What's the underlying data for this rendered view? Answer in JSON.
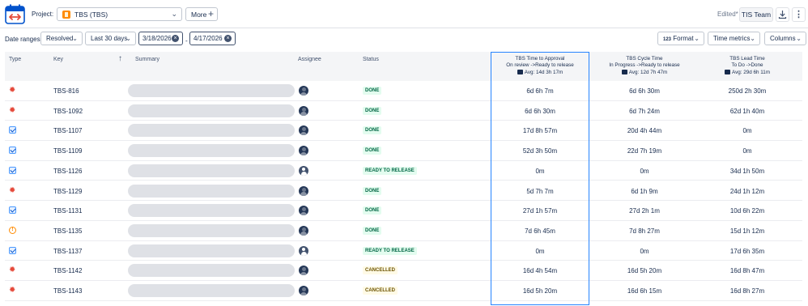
{
  "header": {
    "project_label": "Project:",
    "project_value": "TBS (TBS)",
    "more_label": "More",
    "edited_label": "Edited*",
    "team_label": "TIS Team"
  },
  "filters": {
    "date_ranges_label": "Date ranges:",
    "status_filter": "Resolved",
    "period_filter": "Last 30 days",
    "date_from": "3/18/2026",
    "date_separator": "-",
    "date_to": "4/17/2026",
    "format_label": "Format",
    "time_metrics_label": "Time metrics",
    "columns_label": "Columns"
  },
  "table": {
    "columns": {
      "type": "Type",
      "key": "Key",
      "summary": "Summary",
      "assignee": "Assignee",
      "status": "Status"
    },
    "metric_columns": [
      {
        "title": "TBS Time to Approval",
        "subtitle": "On review ->Ready to release",
        "avg": "Avg: 14d 3h 17m"
      },
      {
        "title": "TBS Cycle Time",
        "subtitle": "In Progress ->Ready to release",
        "avg": "Avg: 12d 7h 47m"
      },
      {
        "title": "TBS Lead Time",
        "subtitle": "To Do ->Done",
        "avg": "Avg: 29d 6h 11m"
      }
    ],
    "rows": [
      {
        "type": "bug",
        "key": "TBS-816",
        "avatar": "photo",
        "status": "DONE",
        "approval": "6d 6h 7m",
        "cycle": "6d 6h 30m",
        "lead": "250d 2h 30m"
      },
      {
        "type": "bug",
        "key": "TBS-1092",
        "avatar": "photo",
        "status": "DONE",
        "approval": "6d 6h 30m",
        "cycle": "6d 7h 24m",
        "lead": "62d 1h 40m"
      },
      {
        "type": "task",
        "key": "TBS-1107",
        "avatar": "photo",
        "status": "DONE",
        "approval": "17d 8h 57m",
        "cycle": "20d 4h 44m",
        "lead": "0m"
      },
      {
        "type": "task",
        "key": "TBS-1109",
        "avatar": "photo",
        "status": "DONE",
        "approval": "52d 3h 50m",
        "cycle": "22d 7h 19m",
        "lead": "0m"
      },
      {
        "type": "task",
        "key": "TBS-1126",
        "avatar": "generic",
        "status": "READY TO RELEASE",
        "approval": "0m",
        "cycle": "0m",
        "lead": "34d 1h 50m"
      },
      {
        "type": "bug",
        "key": "TBS-1129",
        "avatar": "photo",
        "status": "DONE",
        "approval": "5d 7h 7m",
        "cycle": "6d 1h 9m",
        "lead": "24d 1h 12m"
      },
      {
        "type": "task",
        "key": "TBS-1131",
        "avatar": "photo",
        "status": "DONE",
        "approval": "27d 1h 57m",
        "cycle": "27d 2h 1m",
        "lead": "10d 6h 22m"
      },
      {
        "type": "warn",
        "key": "TBS-1135",
        "avatar": "photo",
        "status": "DONE",
        "approval": "7d 6h 45m",
        "cycle": "7d 8h 27m",
        "lead": "15d 1h 12m"
      },
      {
        "type": "task",
        "key": "TBS-1137",
        "avatar": "generic",
        "status": "READY TO RELEASE",
        "approval": "0m",
        "cycle": "0m",
        "lead": "17d 6h 35m"
      },
      {
        "type": "bug",
        "key": "TBS-1142",
        "avatar": "photo",
        "status": "CANCELLED",
        "approval": "16d 4h 54m",
        "cycle": "16d 5h 20m",
        "lead": "16d 8h 47m"
      },
      {
        "type": "bug",
        "key": "TBS-1143",
        "avatar": "photo",
        "status": "CANCELLED",
        "approval": "16d 5h 20m",
        "cycle": "16d 6h 15m",
        "lead": "16d 8h 27m"
      }
    ]
  },
  "colors": {
    "highlight": "#2684ff",
    "bug": "#e5493a",
    "task": "#4c9aff",
    "warning": "#ff8b00"
  }
}
